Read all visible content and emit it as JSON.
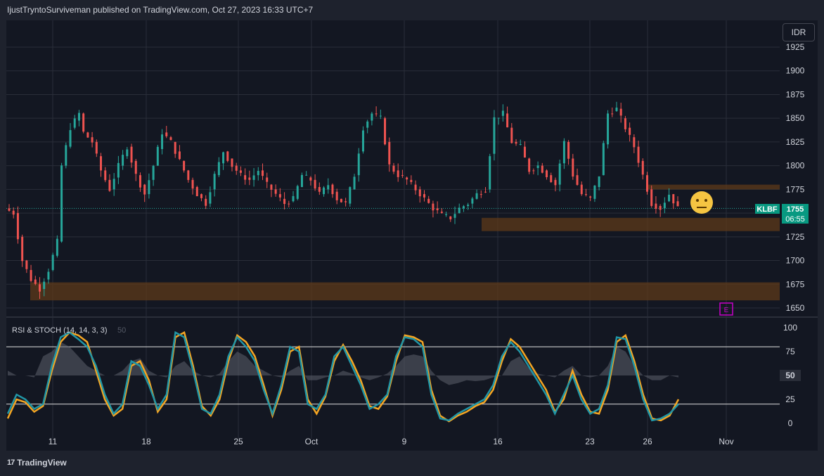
{
  "header": {
    "publisher_line": "IjustTryntoSurviveman published on TradingView.com, Oct 27, 2023 16:33 UTC+7"
  },
  "footer": {
    "brand": "TradingView",
    "logo_glyph": "17"
  },
  "toolbar": {
    "currency": "IDR"
  },
  "colors": {
    "bg": "#131722",
    "up": "#26a69a",
    "down": "#ef5350",
    "zone": "#5d3a1a",
    "rsi": "#2196a6",
    "stoch_k": "#f5a623",
    "grid": "#2a2e39",
    "label_bg": "#089981"
  },
  "chart_data": [
    {
      "type": "candlestick",
      "symbol": "KLBF",
      "currency": "IDR",
      "ylim": [
        1640,
        1935
      ],
      "y_ticks": [
        1650,
        1675,
        1700,
        1725,
        1750,
        1775,
        1800,
        1825,
        1850,
        1875,
        1900,
        1925
      ],
      "x_ticks": [
        "11",
        "18",
        "25",
        "Oct",
        "9",
        "16",
        "23",
        "26",
        "Nov"
      ],
      "last_price": "1755",
      "countdown": "06:55",
      "price_path": [
        [
          0,
          1755
        ],
        [
          2,
          1750
        ],
        [
          4,
          1700
        ],
        [
          6,
          1680
        ],
        [
          8,
          1670
        ],
        [
          10,
          1690
        ],
        [
          12,
          1720
        ],
        [
          13,
          1800
        ],
        [
          15,
          1840
        ],
        [
          17,
          1855
        ],
        [
          18,
          1835
        ],
        [
          20,
          1825
        ],
        [
          22,
          1795
        ],
        [
          24,
          1775
        ],
        [
          26,
          1800
        ],
        [
          28,
          1820
        ],
        [
          30,
          1790
        ],
        [
          32,
          1770
        ],
        [
          34,
          1800
        ],
        [
          36,
          1835
        ],
        [
          38,
          1825
        ],
        [
          40,
          1805
        ],
        [
          42,
          1785
        ],
        [
          44,
          1770
        ],
        [
          46,
          1760
        ],
        [
          48,
          1790
        ],
        [
          50,
          1815
        ],
        [
          52,
          1800
        ],
        [
          54,
          1790
        ],
        [
          56,
          1785
        ],
        [
          58,
          1795
        ],
        [
          60,
          1780
        ],
        [
          62,
          1770
        ],
        [
          64,
          1760
        ],
        [
          66,
          1765
        ],
        [
          68,
          1790
        ],
        [
          70,
          1785
        ],
        [
          72,
          1770
        ],
        [
          74,
          1780
        ],
        [
          76,
          1765
        ],
        [
          78,
          1760
        ],
        [
          80,
          1790
        ],
        [
          82,
          1840
        ],
        [
          84,
          1855
        ],
        [
          86,
          1850
        ],
        [
          88,
          1800
        ],
        [
          90,
          1790
        ],
        [
          92,
          1785
        ],
        [
          94,
          1775
        ],
        [
          96,
          1765
        ],
        [
          98,
          1755
        ],
        [
          100,
          1748
        ],
        [
          102,
          1745
        ],
        [
          104,
          1755
        ],
        [
          106,
          1760
        ],
        [
          108,
          1770
        ],
        [
          110,
          1775
        ],
        [
          112,
          1850
        ],
        [
          114,
          1855
        ],
        [
          116,
          1825
        ],
        [
          118,
          1820
        ],
        [
          120,
          1795
        ],
        [
          122,
          1800
        ],
        [
          124,
          1790
        ],
        [
          126,
          1780
        ],
        [
          128,
          1825
        ],
        [
          130,
          1790
        ],
        [
          132,
          1770
        ],
        [
          134,
          1765
        ],
        [
          136,
          1790
        ],
        [
          138,
          1855
        ],
        [
          140,
          1860
        ],
        [
          142,
          1840
        ],
        [
          144,
          1820
        ],
        [
          146,
          1790
        ],
        [
          148,
          1760
        ],
        [
          150,
          1755
        ],
        [
          152,
          1770
        ],
        [
          154,
          1755
        ]
      ]
    },
    {
      "type": "line",
      "title": "RSI & STOCH (14, 14, 3, 3)",
      "extra_value": "50",
      "ylim": [
        0,
        100
      ],
      "y_ticks": [
        0,
        25,
        50,
        75,
        100
      ],
      "levels": [
        80,
        20
      ],
      "series": [
        {
          "key": "stoch_d",
          "values": [
            10,
            30,
            25,
            15,
            20,
            60,
            90,
            95,
            88,
            80,
            60,
            30,
            10,
            20,
            65,
            60,
            40,
            15,
            30,
            95,
            90,
            55,
            15,
            10,
            30,
            70,
            90,
            80,
            65,
            35,
            10,
            40,
            80,
            75,
            20,
            15,
            30,
            70,
            80,
            60,
            40,
            15,
            20,
            30,
            70,
            90,
            88,
            80,
            30,
            5,
            3,
            10,
            15,
            20,
            25,
            40,
            70,
            85,
            75,
            60,
            45,
            30,
            10,
            30,
            50,
            25,
            10,
            15,
            40,
            90,
            88,
            60,
            25,
            3,
            5,
            10,
            20
          ]
        },
        {
          "key": "stoch_k",
          "values": [
            5,
            25,
            22,
            12,
            18,
            55,
            85,
            95,
            92,
            85,
            55,
            25,
            8,
            15,
            60,
            65,
            45,
            12,
            25,
            90,
            95,
            60,
            18,
            8,
            25,
            65,
            92,
            85,
            70,
            40,
            8,
            35,
            75,
            80,
            25,
            10,
            28,
            65,
            82,
            65,
            45,
            18,
            15,
            28,
            65,
            92,
            90,
            85,
            35,
            8,
            2,
            8,
            12,
            18,
            22,
            35,
            65,
            88,
            80,
            65,
            50,
            35,
            12,
            25,
            55,
            30,
            12,
            10,
            35,
            85,
            92,
            65,
            30,
            5,
            3,
            8,
            25
          ]
        },
        {
          "key": "rsi",
          "values": [
            55,
            50,
            50,
            48,
            70,
            75,
            85,
            80,
            70,
            60,
            55,
            50,
            50,
            55,
            65,
            68,
            55,
            50,
            48,
            60,
            65,
            55,
            50,
            48,
            52,
            65,
            75,
            70,
            60,
            55,
            50,
            48,
            55,
            60,
            45,
            45,
            48,
            50,
            55,
            52,
            48,
            45,
            48,
            52,
            60,
            70,
            72,
            70,
            55,
            45,
            40,
            42,
            45,
            44,
            45,
            48,
            50,
            65,
            70,
            58,
            52,
            50,
            48,
            55,
            60,
            50,
            48,
            50,
            60,
            80,
            75,
            60,
            50,
            45,
            45,
            50,
            48
          ]
        }
      ]
    }
  ]
}
